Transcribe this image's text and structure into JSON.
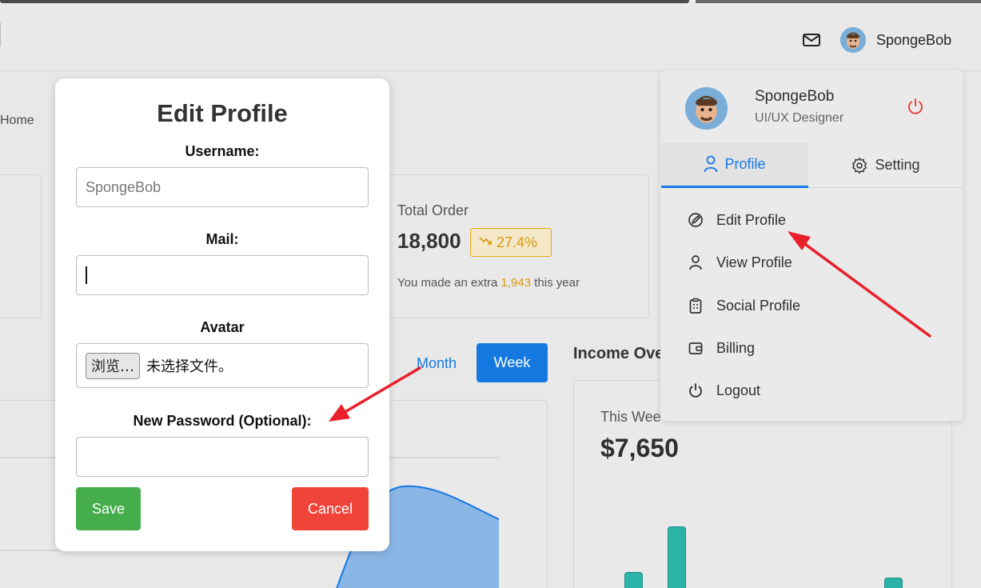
{
  "header": {
    "user_name": "SpongeBob"
  },
  "breadcrumb": {
    "home": "Home"
  },
  "total_order": {
    "title": "Total Order",
    "value": "18,800",
    "badge": "27.4%",
    "note_prefix": "You made an extra ",
    "note_highlight": "1,943",
    "note_suffix": " this year"
  },
  "range_toggle": {
    "month": "Month",
    "week": "Week"
  },
  "income": {
    "title": "Income Ove",
    "period_label": "This Wee",
    "value": "$7,650"
  },
  "profile_menu": {
    "name": "SpongeBob",
    "role": "UI/UX Designer",
    "tabs": {
      "profile": "Profile",
      "setting": "Setting"
    },
    "items": {
      "edit_profile": "Edit Profile",
      "view_profile": "View Profile",
      "social_profile": "Social Profile",
      "billing": "Billing",
      "logout": "Logout"
    }
  },
  "edit_modal": {
    "title": "Edit Profile",
    "username_label": "Username:",
    "username_placeholder": "SpongeBob",
    "mail_label": "Mail:",
    "avatar_label": "Avatar",
    "file_button": "浏览…",
    "file_status": "未选择文件。",
    "password_label": "New Password (Optional):",
    "save": "Save",
    "cancel": "Cancel"
  },
  "colors": {
    "accent_blue": "#1677e5",
    "warning_orange": "#d99a10",
    "save_green": "#46ad4c",
    "cancel_red": "#f0443a",
    "bar_teal": "#2bb3a8",
    "annotation_red": "#e8202a"
  }
}
